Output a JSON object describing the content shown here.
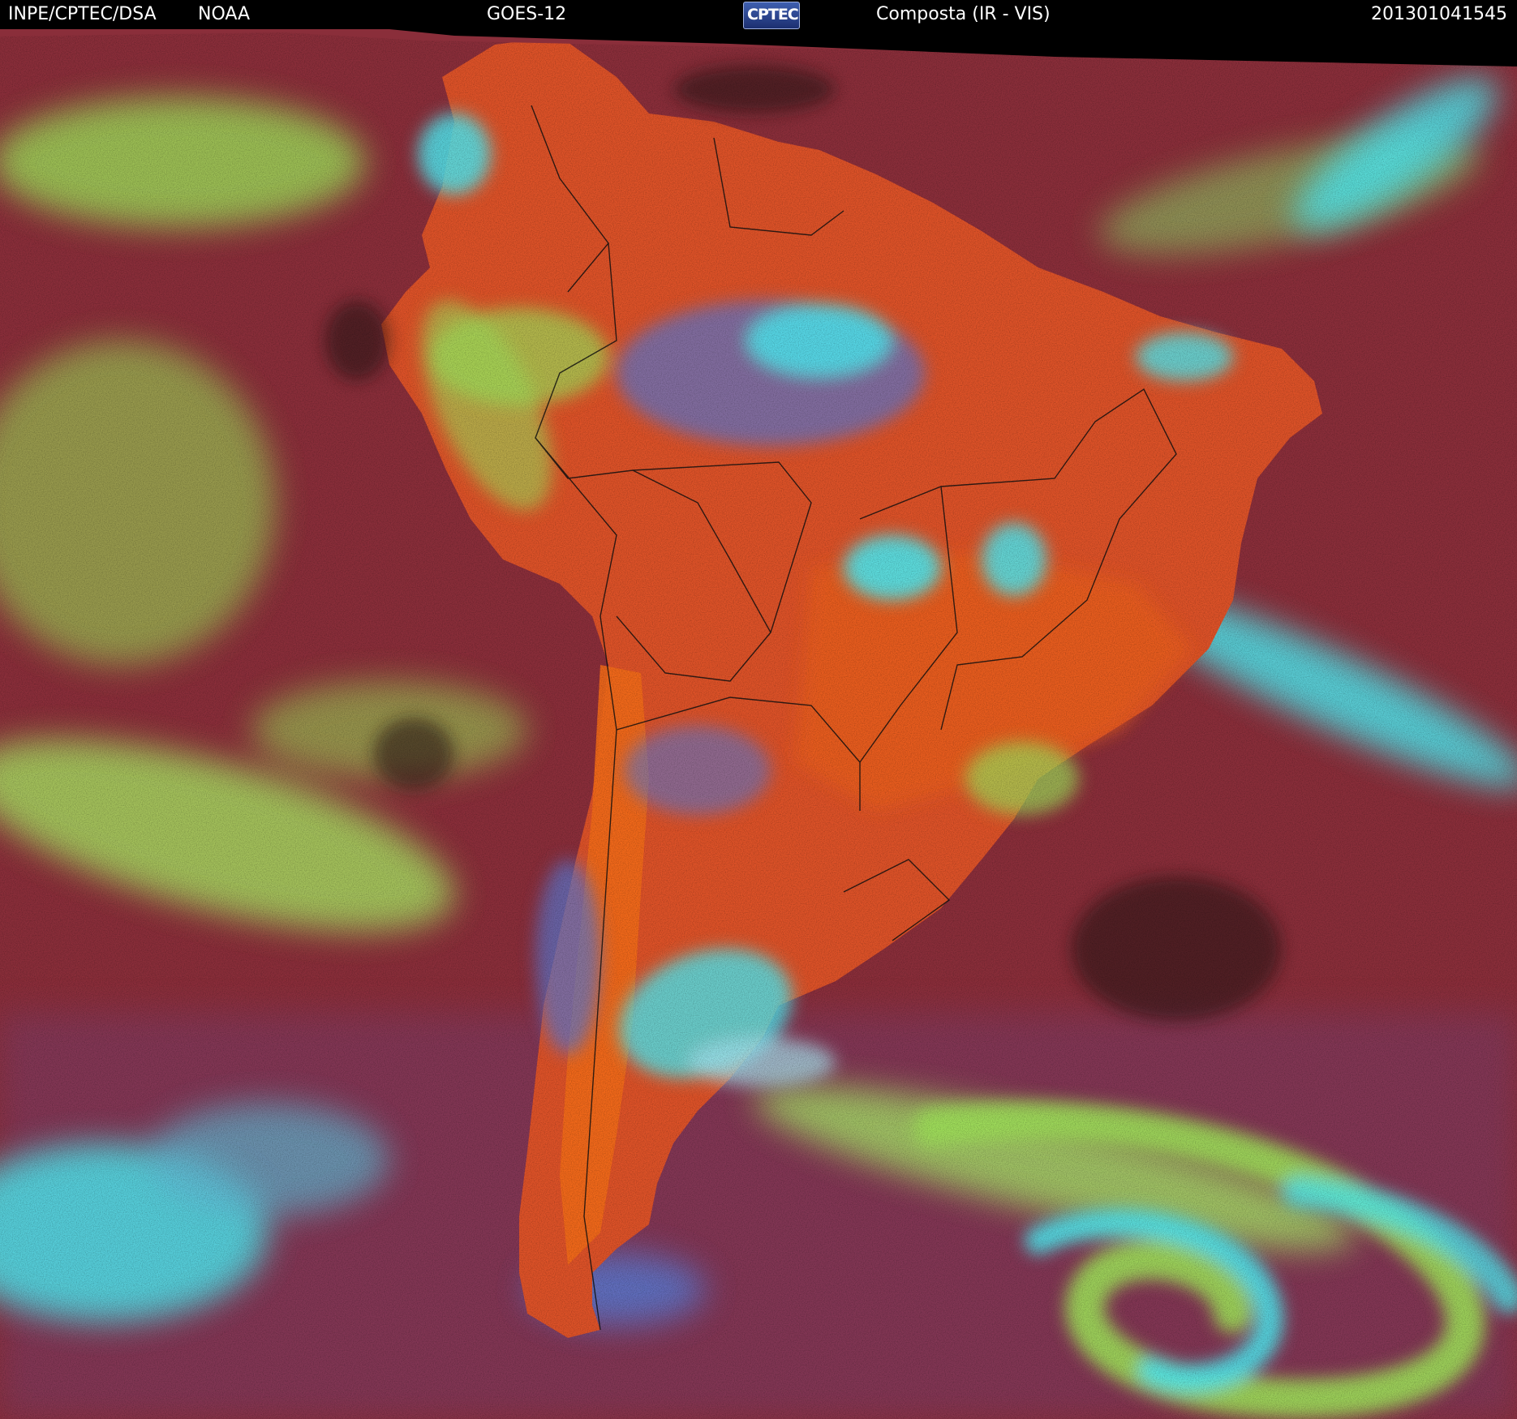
{
  "header": {
    "source": "INPE/CPTEC/DSA",
    "agency": "NOAA",
    "satellite": "GOES-12",
    "logo_text": "CPTEC",
    "product": "Composta (IR - VIS)",
    "timestamp": "201301041545"
  },
  "colors": {
    "ocean_clear": "#8a2e3a",
    "land_warm": "#e85a24",
    "land_hot": "#f26a18",
    "low_cloud": "#9ee05a",
    "high_cloud": "#4ee8f0",
    "mid_cloud": "#5a78d0",
    "cold_spots": "#2a1418",
    "borders": "#111111"
  }
}
